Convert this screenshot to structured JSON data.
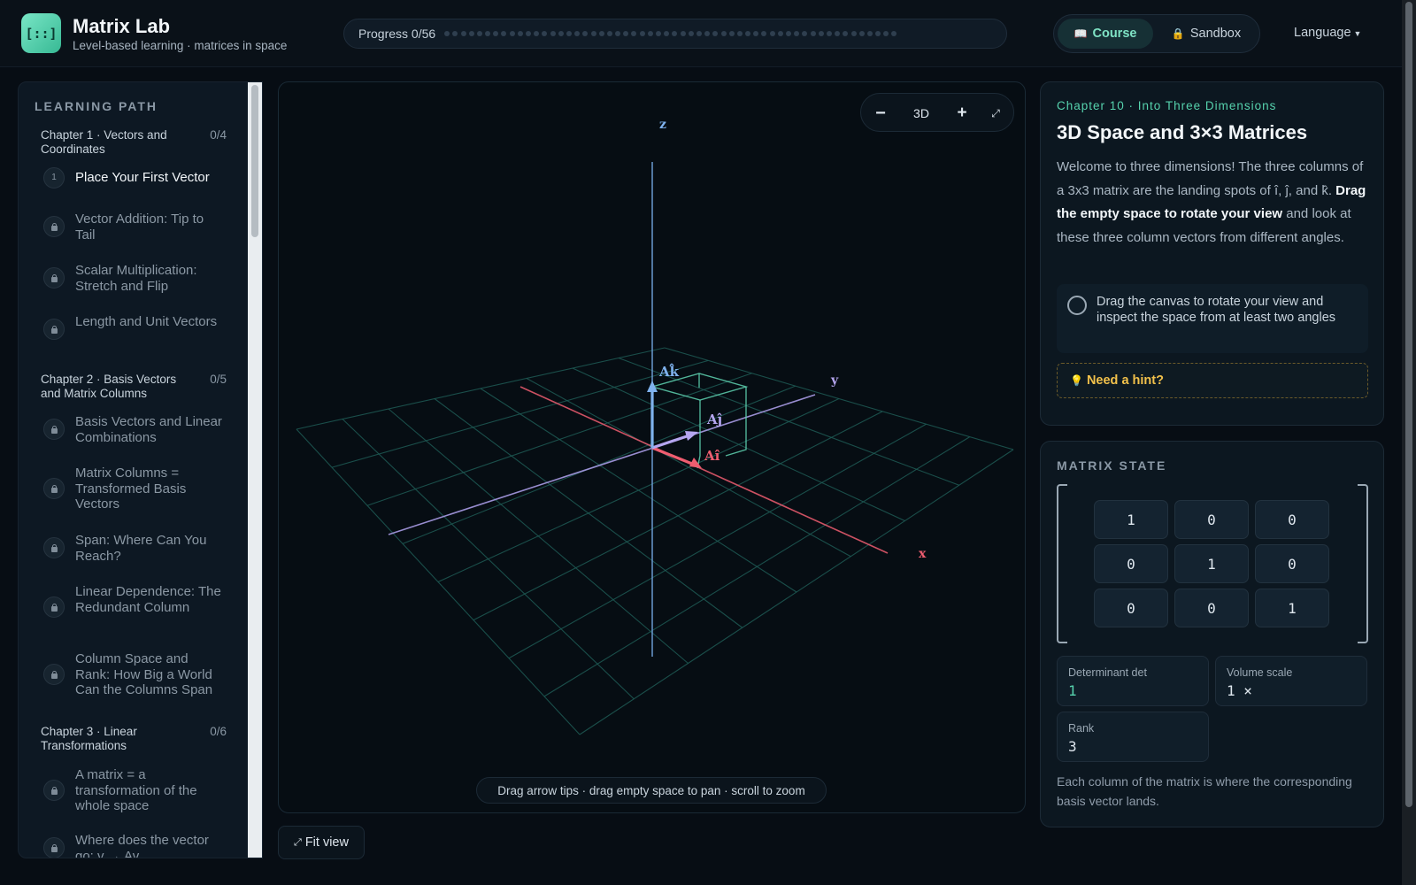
{
  "header": {
    "logo_glyph": "[::]",
    "title": "Matrix Lab",
    "subtitle": "Level-based learning · matrices in space",
    "progress_label": "Progress 0/56",
    "progress_completed": 0,
    "progress_total": 56,
    "mode_tabs": [
      {
        "label": "Course",
        "icon": "book-icon",
        "active": true
      },
      {
        "label": "Sandbox",
        "icon": "lock-icon",
        "active": false
      }
    ],
    "language_label": "Language"
  },
  "sidebar": {
    "heading": "LEARNING PATH",
    "chapters": [
      {
        "title": "Chapter 1 · Vectors and Coordinates",
        "count": "0/4",
        "lessons": [
          {
            "number": "1",
            "label": "Place Your First Vector",
            "locked": false
          },
          {
            "label": "Vector Addition: Tip to Tail",
            "locked": true
          },
          {
            "label": "Scalar Multiplication: Stretch and Flip",
            "locked": true
          },
          {
            "label": "Length and Unit Vectors",
            "locked": true
          }
        ]
      },
      {
        "title": "Chapter 2 · Basis Vectors and Matrix Columns",
        "count": "0/5",
        "lessons": [
          {
            "label": "Basis Vectors and Linear Combinations",
            "locked": true
          },
          {
            "label": "Matrix Columns = Transformed Basis Vectors",
            "locked": true
          },
          {
            "label": "Span: Where Can You Reach?",
            "locked": true
          },
          {
            "label": "Linear Dependence: The Redundant Column",
            "locked": true
          },
          {
            "label": "Column Space and Rank: How Big a World Can the Columns Span",
            "locked": true
          }
        ]
      },
      {
        "title": "Chapter 3 · Linear Transformations",
        "count": "0/6",
        "lessons": [
          {
            "label": "A matrix = a transformation of the whole space",
            "locked": true
          },
          {
            "label": "Where does the vector go: v → Av",
            "locked": true
          }
        ]
      }
    ]
  },
  "canvas": {
    "axis_labels": {
      "x": "x",
      "y": "y",
      "z": "z"
    },
    "vector_labels": {
      "i": "Aî",
      "j": "Aĵ",
      "k": "Ak̂"
    },
    "controls": {
      "minus": "−",
      "mode": "3D",
      "plus": "+",
      "expand": "⤢"
    },
    "hint": "Drag arrow tips · drag empty space to pan · scroll to zoom",
    "fit_view_icon": "⤢",
    "fit_view_label": "Fit view",
    "colors": {
      "x_axis": "#e2596b",
      "y_axis": "#a99be6",
      "z_axis": "#6f9fd8",
      "grid": "#1f5a55",
      "cube": "#5fd3b1"
    }
  },
  "lesson": {
    "chapter": "Chapter 10 · Into Three Dimensions",
    "title": "3D Space and 3×3 Matrices",
    "body_1": "Welcome to three dimensions! The three columns of a 3x3 matrix are the landing spots of î, ĵ, and k̂. ",
    "body_bold": "Drag the empty space to rotate your view",
    "body_2": " and look at these three column vectors from different angles.",
    "task": "Drag the canvas to rotate your view and inspect the space from at least two angles",
    "hint_icon": "💡",
    "hint_label": "Need a hint?"
  },
  "matrix_state": {
    "heading": "MATRIX STATE",
    "matrix": [
      [
        "1",
        "0",
        "0"
      ],
      [
        "0",
        "1",
        "0"
      ],
      [
        "0",
        "0",
        "1"
      ]
    ],
    "determinant_label": "Determinant det",
    "determinant_value": "1",
    "volume_label": "Volume scale",
    "volume_value": "1 ×",
    "rank_label": "Rank",
    "rank_value": "3",
    "note": "Each column of the matrix is where the corresponding basis vector lands."
  },
  "theme": {
    "accent": "#56d2ad",
    "background": "#070d14",
    "hint": "#f2c14b"
  }
}
